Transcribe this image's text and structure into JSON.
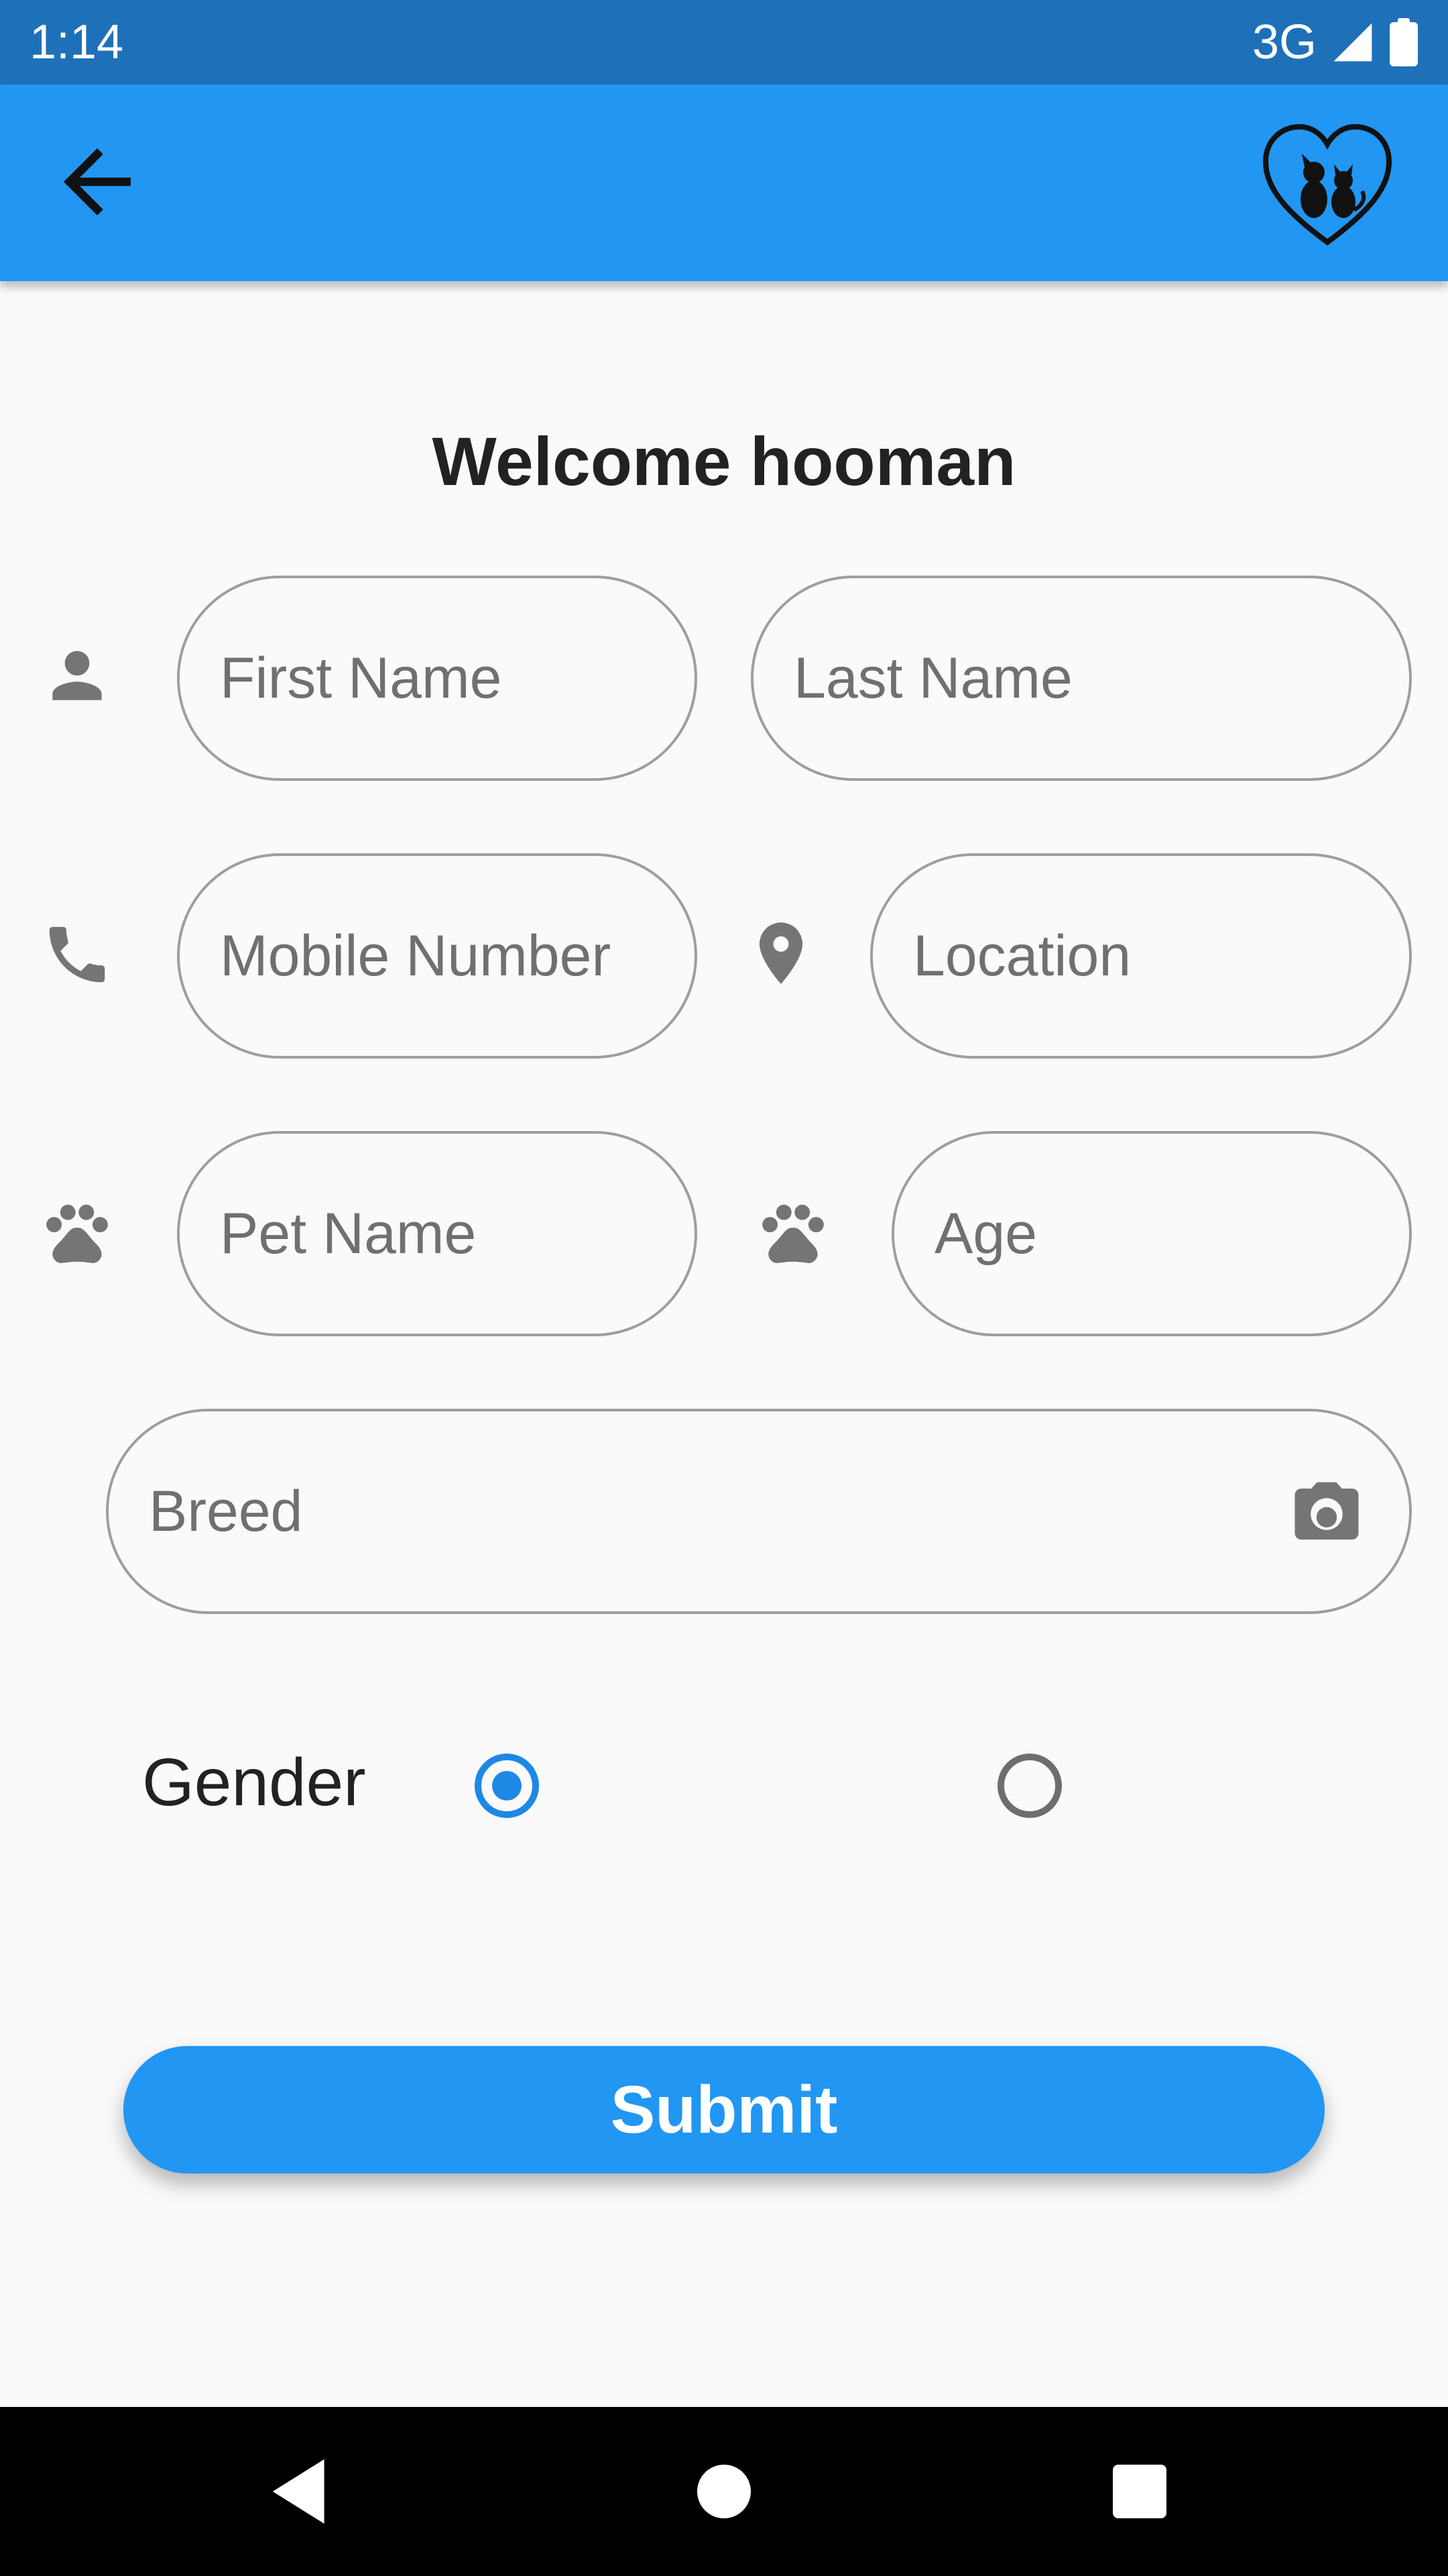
{
  "status_bar": {
    "time": "1:14",
    "network": "3G"
  },
  "app_bar": {
    "back_icon": "arrow-back-icon",
    "logo_icon": "pawvu-logo-icon"
  },
  "title": "Welcome hooman",
  "form": {
    "first_name": {
      "placeholder": "First Name",
      "value": ""
    },
    "last_name": {
      "placeholder": "Last Name",
      "value": ""
    },
    "mobile": {
      "placeholder": "Mobile Number",
      "value": ""
    },
    "location": {
      "placeholder": "Location",
      "value": ""
    },
    "pet_name": {
      "placeholder": "Pet Name",
      "value": ""
    },
    "age": {
      "placeholder": "Age",
      "value": ""
    },
    "breed": {
      "placeholder": "Breed",
      "value": ""
    }
  },
  "gender": {
    "label": "Gender",
    "selected_index": 0
  },
  "submit_label": "Submit",
  "colors": {
    "primary": "#2196f3",
    "status_bar": "#1e70b8",
    "radio_selected": "#1e88e5",
    "icon_gray": "#757575"
  }
}
